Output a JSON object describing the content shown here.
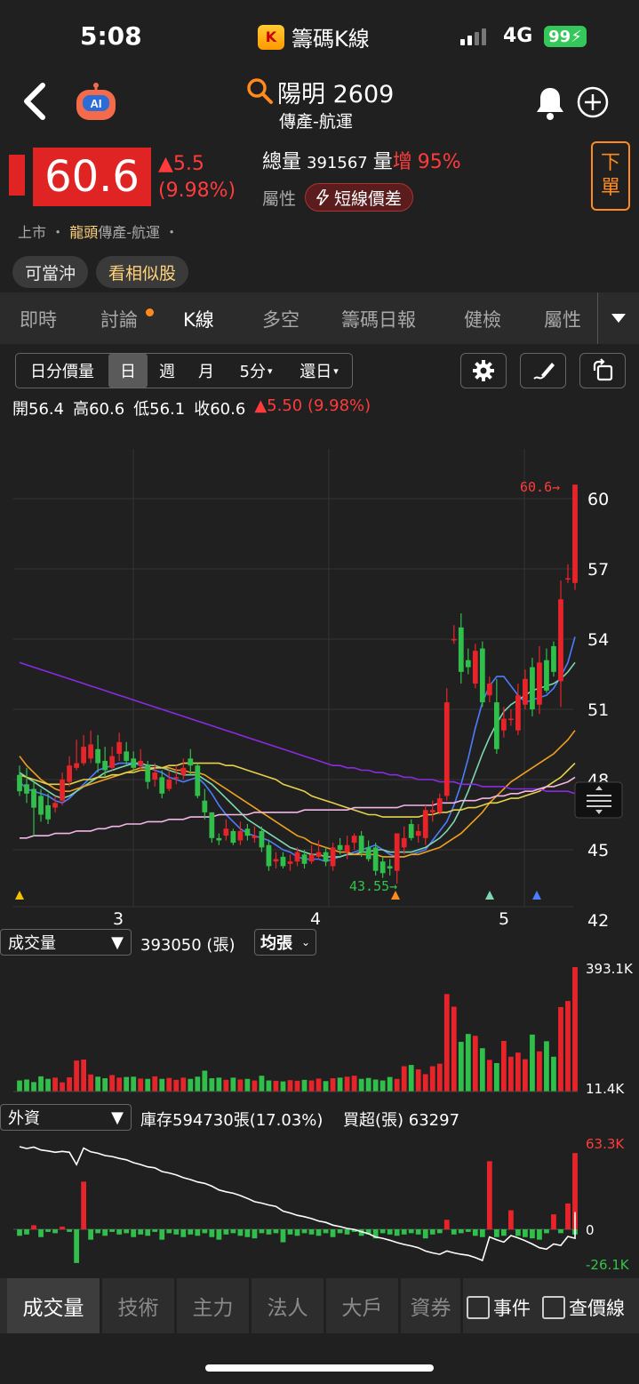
{
  "status": {
    "time": "5:08",
    "app_title": "籌碼K線",
    "app_logo": "K",
    "network": "4G",
    "battery": "99"
  },
  "header": {
    "stock_title": "陽明 2609",
    "stock_sub": "傳產-航運"
  },
  "price": {
    "last": "60.6",
    "change": "▲5.5",
    "change_pct": "(9.98%)",
    "total_label": "總量",
    "total_value": "391567",
    "vol_label": "量",
    "vol_up": "增",
    "vol_pct": "95%",
    "attr_label": "屬性",
    "attr_badge": "短線價差",
    "order_1": "下",
    "order_2": "單",
    "market": "上市 ・ ",
    "market_gold": "龍頭",
    "market_rest": "傳產-航運 ・"
  },
  "pills": [
    "可當沖",
    "看相似股"
  ],
  "tabs": [
    "即時",
    "討論",
    "K線",
    "多空",
    "籌碼日報",
    "健檢",
    "屬性"
  ],
  "periods": [
    "日分價量",
    "日",
    "週",
    "月",
    "5分",
    "還日"
  ],
  "ohlc": {
    "open_label": "開",
    "open": "56.4",
    "high_label": "高",
    "high": "60.6",
    "low_label": "低",
    "low": "56.1",
    "close_label": "收",
    "close": "60.6",
    "change": "▲5.50 (9.98%)"
  },
  "chart_main": {
    "y_ticks": [
      "60",
      "57",
      "54",
      "51",
      "48",
      "45",
      "42"
    ],
    "x_ticks": [
      "3",
      "4",
      "5"
    ],
    "high_mark": "60.6→",
    "low_mark": "43.55→"
  },
  "volume_panel": {
    "selector": "成交量",
    "value": "393050 (張)",
    "unit_btn": "均張",
    "max": "393.1K",
    "min": "11.4K"
  },
  "foreign_panel": {
    "selector": "外資",
    "holding": "庫存594730張(17.03%)",
    "net": "買超(張) 63297",
    "max": "63.3K",
    "zero": "0",
    "min": "-26.1K"
  },
  "bottom_tabs": [
    "成交量",
    "技術",
    "主力",
    "法人",
    "大戶",
    "資券"
  ],
  "checkboxes": [
    "事件",
    "查價線"
  ],
  "colors": {
    "up": "#e8242b",
    "down": "#2fbf4a",
    "accent": "#ff8a1f"
  },
  "chart_data": [
    {
      "type": "candlestick",
      "title": "",
      "y_range": [
        42,
        61
      ],
      "x_tick_labels": [
        "3",
        "4",
        "5"
      ],
      "candles": [
        [
          48.2,
          47.5,
          48.6,
          47.3
        ],
        [
          47.8,
          47.4,
          48.5,
          47.0
        ],
        [
          47.6,
          46.8,
          47.9,
          45.6
        ],
        [
          47.3,
          46.5,
          47.6,
          46.2
        ],
        [
          46.9,
          46.3,
          47.4,
          46.1
        ],
        [
          46.8,
          47.0,
          47.3,
          46.6
        ],
        [
          47.1,
          48.0,
          48.3,
          46.9
        ],
        [
          47.9,
          48.6,
          49.0,
          47.7
        ],
        [
          48.5,
          48.7,
          49.7,
          48.4
        ],
        [
          48.7,
          49.4,
          49.9,
          48.6
        ],
        [
          48.9,
          49.5,
          50.1,
          48.7
        ],
        [
          49.3,
          48.7,
          49.9,
          48.3
        ],
        [
          48.8,
          48.4,
          49.4,
          48.1
        ],
        [
          48.5,
          49.0,
          49.4,
          48.4
        ],
        [
          49.1,
          49.6,
          50.0,
          48.8
        ],
        [
          49.2,
          48.8,
          49.6,
          48.6
        ],
        [
          48.9,
          48.5,
          49.2,
          48.3
        ],
        [
          48.6,
          48.8,
          49.3,
          48.4
        ],
        [
          48.6,
          47.9,
          48.8,
          47.6
        ],
        [
          48.0,
          48.3,
          48.7,
          47.7
        ],
        [
          48.1,
          47.4,
          48.4,
          47.2
        ],
        [
          47.6,
          48.0,
          48.4,
          47.5
        ],
        [
          48.1,
          48.1,
          48.6,
          47.8
        ],
        [
          48.2,
          48.5,
          48.9,
          48.0
        ],
        [
          48.9,
          48.6,
          49.3,
          48.2
        ],
        [
          48.6,
          47.3,
          48.7,
          47.2
        ],
        [
          47.1,
          46.6,
          47.6,
          46.3
        ],
        [
          46.6,
          45.5,
          46.6,
          45.3
        ],
        [
          45.5,
          45.4,
          45.7,
          45.2
        ],
        [
          45.6,
          45.9,
          46.3,
          45.4
        ],
        [
          45.8,
          45.3,
          45.9,
          45.2
        ],
        [
          45.4,
          45.8,
          46.2,
          45.2
        ],
        [
          45.9,
          45.6,
          46.1,
          45.4
        ],
        [
          45.5,
          45.6,
          46.0,
          45.3
        ],
        [
          45.8,
          45.1,
          46.0,
          44.9
        ],
        [
          45.2,
          44.3,
          45.4,
          44.1
        ],
        [
          44.5,
          44.6,
          44.9,
          44.2
        ],
        [
          44.7,
          44.3,
          44.9,
          44.2
        ],
        [
          44.4,
          44.5,
          44.8,
          44.1
        ],
        [
          44.5,
          44.9,
          45.1,
          44.3
        ],
        [
          44.8,
          44.4,
          45.0,
          44.2
        ],
        [
          44.5,
          44.8,
          45.2,
          44.4
        ],
        [
          44.7,
          44.9,
          45.4,
          44.6
        ],
        [
          44.9,
          44.5,
          45.1,
          44.3
        ],
        [
          44.3,
          45.1,
          45.3,
          44.1
        ],
        [
          45.2,
          45.0,
          45.5,
          44.8
        ],
        [
          44.9,
          45.2,
          45.6,
          44.6
        ],
        [
          45.3,
          45.6,
          45.7,
          45.0
        ],
        [
          45.6,
          44.9,
          45.8,
          44.7
        ],
        [
          45.1,
          44.6,
          45.4,
          44.5
        ],
        [
          45.1,
          44.1,
          45.3,
          43.9
        ],
        [
          44.5,
          44.0,
          44.7,
          43.8
        ],
        [
          44.3,
          44.2,
          44.6,
          43.9
        ],
        [
          44.1,
          45.7,
          45.7,
          43.55
        ],
        [
          45.1,
          45.5,
          46.0,
          44.8
        ],
        [
          46.1,
          45.5,
          46.3,
          45.4
        ],
        [
          45.6,
          45.8,
          46.1,
          45.3
        ],
        [
          45.5,
          46.7,
          46.9,
          45.2
        ],
        [
          46.6,
          46.7,
          47.1,
          46.2
        ],
        [
          46.6,
          47.2,
          47.4,
          46.5
        ],
        [
          47.3,
          51.3,
          51.9,
          47.1
        ],
        [
          54.0,
          54.0,
          54.6,
          53.8
        ],
        [
          54.5,
          52.6,
          55.1,
          52.1
        ],
        [
          53.1,
          52.8,
          53.6,
          52.5
        ],
        [
          52.1,
          53.5,
          53.8,
          51.9
        ],
        [
          53.6,
          51.3,
          53.9,
          51.1
        ],
        [
          51.6,
          52.1,
          52.4,
          51.3
        ],
        [
          51.3,
          49.3,
          52.3,
          49.1
        ],
        [
          50.1,
          50.6,
          51.1,
          49.8
        ],
        [
          50.6,
          50.6,
          51.0,
          50.3
        ],
        [
          50.1,
          51.6,
          52.1,
          49.9
        ],
        [
          51.2,
          52.3,
          52.7,
          51.0
        ],
        [
          52.8,
          51.0,
          53.2,
          50.7
        ],
        [
          51.2,
          53.0,
          53.7,
          50.8
        ],
        [
          53.1,
          51.8,
          53.6,
          51.7
        ],
        [
          53.7,
          52.6,
          53.9,
          52.4
        ],
        [
          52.2,
          55.7,
          56.5,
          51.1
        ],
        [
          56.6,
          56.6,
          57.2,
          56.4
        ],
        [
          56.4,
          60.6,
          60.6,
          56.1
        ]
      ],
      "ma_lines": [
        [
          47.9,
          47.6,
          47.5,
          47.4,
          47.3,
          47.1,
          47.0,
          47.2,
          47.5,
          47.8,
          48.1,
          48.4,
          48.5,
          48.6,
          48.7,
          48.7,
          48.7,
          48.6,
          48.5,
          48.4,
          48.3,
          48.1,
          48.0,
          47.9,
          48.0,
          48.1,
          47.8,
          47.4,
          46.9,
          46.5,
          46.2,
          45.9,
          45.7,
          45.6,
          45.5,
          45.4,
          45.2,
          45.0,
          44.9,
          44.7,
          44.6,
          44.6,
          44.6,
          44.5,
          44.6,
          44.7,
          44.8,
          44.9,
          45.0,
          45.1,
          45.2,
          45.0,
          44.8,
          44.7,
          44.7,
          44.8,
          44.9,
          45.0,
          45.4,
          45.8,
          46.2,
          46.9,
          47.8,
          48.9,
          50.2,
          51.3,
          52.0,
          52.4,
          52.4,
          52.0,
          51.6,
          51.3,
          51.4,
          51.5,
          51.6,
          51.9,
          52.4,
          53.0,
          54.1
        ],
        [
          48.3,
          48.1,
          47.9,
          47.7,
          47.5,
          47.3,
          47.2,
          47.3,
          47.5,
          47.7,
          47.9,
          48.1,
          48.3,
          48.4,
          48.5,
          48.6,
          48.7,
          48.7,
          48.6,
          48.6,
          48.5,
          48.4,
          48.3,
          48.2,
          48.2,
          48.2,
          48.0,
          47.8,
          47.5,
          47.2,
          46.9,
          46.6,
          46.3,
          46.1,
          45.9,
          45.7,
          45.5,
          45.3,
          45.1,
          45.0,
          44.9,
          44.8,
          44.8,
          44.7,
          44.7,
          44.7,
          44.8,
          44.8,
          44.9,
          44.9,
          45.0,
          45.0,
          44.9,
          44.9,
          44.9,
          44.9,
          45.0,
          45.1,
          45.3,
          45.5,
          45.8,
          46.2,
          46.8,
          47.5,
          48.3,
          49.1,
          49.8,
          50.4,
          50.9,
          51.2,
          51.4,
          51.6,
          51.8,
          51.9,
          52.0,
          52.1,
          52.3,
          52.6,
          53.0
        ],
        [
          49.0,
          48.6,
          48.3,
          48.0,
          47.8,
          47.6,
          47.5,
          47.5,
          47.6,
          47.7,
          47.8,
          47.9,
          48.0,
          48.1,
          48.2,
          48.3,
          48.4,
          48.5,
          48.5,
          48.5,
          48.5,
          48.5,
          48.4,
          48.4,
          48.3,
          48.3,
          48.2,
          48.0,
          47.8,
          47.6,
          47.4,
          47.2,
          47.0,
          46.8,
          46.6,
          46.4,
          46.2,
          46.0,
          45.8,
          45.6,
          45.5,
          45.3,
          45.2,
          45.1,
          45.0,
          44.9,
          44.9,
          44.8,
          44.8,
          44.8,
          44.8,
          44.7,
          44.7,
          44.7,
          44.7,
          44.8,
          44.8,
          44.9,
          45.0,
          45.1,
          45.3,
          45.5,
          45.7,
          46.0,
          46.3,
          46.6,
          47.0,
          47.3,
          47.6,
          47.9,
          48.1,
          48.3,
          48.5,
          48.7,
          48.9,
          49.1,
          49.4,
          49.7,
          50.1
        ],
        [
          48.2,
          48.1,
          48.0,
          47.9,
          47.8,
          47.8,
          47.8,
          47.8,
          47.9,
          48.0,
          48.0,
          48.1,
          48.1,
          48.2,
          48.2,
          48.3,
          48.3,
          48.4,
          48.4,
          48.5,
          48.5,
          48.6,
          48.6,
          48.7,
          48.7,
          48.7,
          48.7,
          48.7,
          48.7,
          48.6,
          48.6,
          48.5,
          48.4,
          48.3,
          48.2,
          48.1,
          48.0,
          47.8,
          47.7,
          47.6,
          47.5,
          47.3,
          47.2,
          47.1,
          47.0,
          46.9,
          46.8,
          46.7,
          46.6,
          46.5,
          46.5,
          46.4,
          46.4,
          46.4,
          46.4,
          46.4,
          46.4,
          46.5,
          46.5,
          46.6,
          46.6,
          46.7,
          46.7,
          46.8,
          46.8,
          46.9,
          47.0,
          47.0,
          47.1,
          47.2,
          47.2,
          47.3,
          47.4,
          47.5,
          47.7,
          47.9,
          48.1,
          48.4,
          48.7
        ],
        [
          53.0,
          52.9,
          52.8,
          52.7,
          52.6,
          52.5,
          52.4,
          52.3,
          52.2,
          52.1,
          52.0,
          51.9,
          51.8,
          51.7,
          51.6,
          51.5,
          51.4,
          51.3,
          51.2,
          51.1,
          51.0,
          50.9,
          50.8,
          50.7,
          50.6,
          50.5,
          50.4,
          50.3,
          50.2,
          50.1,
          50.0,
          49.9,
          49.8,
          49.7,
          49.6,
          49.5,
          49.4,
          49.3,
          49.2,
          49.1,
          49.0,
          48.9,
          48.8,
          48.7,
          48.6,
          48.6,
          48.5,
          48.5,
          48.4,
          48.4,
          48.3,
          48.3,
          48.2,
          48.2,
          48.1,
          48.1,
          48.0,
          48.0,
          48.0,
          47.9,
          47.9,
          47.9,
          47.8,
          47.8,
          47.8,
          47.7,
          47.7,
          47.7,
          47.7,
          47.6,
          47.6,
          47.6,
          47.6,
          47.6,
          47.5,
          47.5,
          47.5,
          47.5,
          47.4
        ],
        [
          45.5,
          45.5,
          45.6,
          45.6,
          45.6,
          45.7,
          45.7,
          45.7,
          45.8,
          45.8,
          45.8,
          45.9,
          45.9,
          46.0,
          46.0,
          46.1,
          46.1,
          46.1,
          46.2,
          46.2,
          46.2,
          46.3,
          46.3,
          46.3,
          46.4,
          46.4,
          46.4,
          46.4,
          46.5,
          46.5,
          46.5,
          46.5,
          46.5,
          46.6,
          46.6,
          46.6,
          46.6,
          46.6,
          46.6,
          46.6,
          46.7,
          46.7,
          46.7,
          46.7,
          46.7,
          46.7,
          46.7,
          46.8,
          46.8,
          46.8,
          46.8,
          46.8,
          46.8,
          46.8,
          46.9,
          46.9,
          46.9,
          46.9,
          46.9,
          47.0,
          47.0,
          47.0,
          47.1,
          47.1,
          47.1,
          47.2,
          47.2,
          47.3,
          47.3,
          47.4,
          47.4,
          47.5,
          47.5,
          47.6,
          47.7,
          47.7,
          47.8,
          47.9,
          48.1
        ]
      ]
    },
    {
      "type": "bar",
      "name": "成交量",
      "y_range": [
        11.4,
        393.1
      ],
      "values": [
        35,
        38,
        30,
        48,
        40,
        44,
        29,
        45,
        98,
        101,
        54,
        47,
        42,
        52,
        44,
        46,
        47,
        41,
        40,
        48,
        40,
        43,
        37,
        44,
        40,
        47,
        66,
        42,
        44,
        37,
        44,
        38,
        40,
        35,
        50,
        35,
        34,
        32,
        36,
        34,
        37,
        35,
        41,
        33,
        42,
        44,
        47,
        50,
        40,
        43,
        38,
        35,
        46,
        40,
        80,
        84,
        70,
        55,
        80,
        88,
        308,
        268,
        157,
        182,
        176,
        137,
        100,
        90,
        160,
        110,
        123,
        102,
        180,
        127,
        159,
        110,
        267,
        286,
        393
      ]
    },
    {
      "type": "bar",
      "name": "外資",
      "y_range": [
        -26.1,
        63.3
      ],
      "values": [
        -5,
        -4,
        3,
        -6,
        -2,
        -3,
        2,
        -2,
        -26,
        35,
        -8,
        -3,
        -5,
        -2,
        -4,
        -3,
        -6,
        -4,
        -5,
        -2,
        -8,
        -3,
        -4,
        -6,
        -4,
        -5,
        -3,
        -6,
        -8,
        -4,
        -3,
        -5,
        -6,
        -7,
        -3,
        -4,
        -3,
        -10,
        -4,
        -5,
        -3,
        -4,
        -5,
        -3,
        -6,
        -3,
        -4,
        -2,
        -5,
        -4,
        -7,
        -3,
        -4,
        -5,
        -4,
        -3,
        -4,
        -7,
        -4,
        -3,
        7,
        -4,
        -3,
        -2,
        -5,
        -6,
        50,
        -6,
        -5,
        14,
        -5,
        -6,
        -7,
        -8,
        -3,
        11,
        -3,
        19,
        -4,
        56
      ]
    }
  ]
}
